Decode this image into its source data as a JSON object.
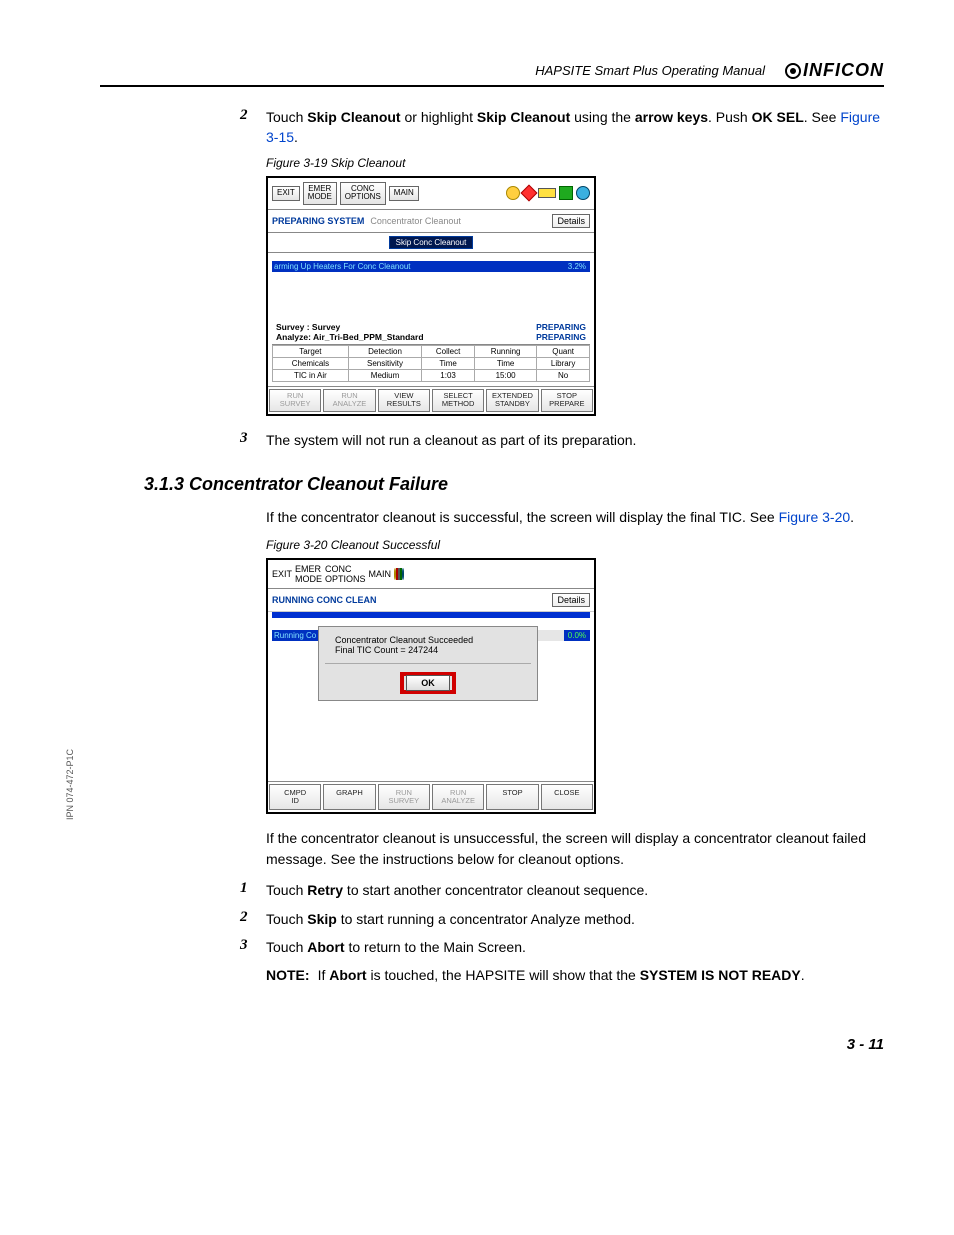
{
  "header": {
    "doc_title": "HAPSITE Smart Plus Operating Manual",
    "logo_text": "INFICON"
  },
  "side_label": "IPN 074-472-P1C",
  "step2": {
    "num": "2",
    "t1": "Touch ",
    "b1": "Skip Cleanout",
    "t2": " or highlight ",
    "b2": "Skip Cleanout",
    "t3": " using the ",
    "b3": "arrow keys",
    "t4": ". Push ",
    "b4": "OK SEL",
    "t5": ". See ",
    "link": "Figure 3-15",
    "t6": "."
  },
  "fig19": {
    "caption": "Figure 3-19  Skip Cleanout",
    "toolbar": {
      "exit": "EXIT",
      "emer1": "EMER",
      "emer2": "MODE",
      "conc1": "CONC",
      "conc2": "OPTIONS",
      "main": "MAIN"
    },
    "status": {
      "prep": "PREPARING SYSTEM",
      "tag": "Concentrator Cleanout",
      "details": "Details"
    },
    "skip_btn": "Skip Conc Cleanout",
    "prog": {
      "msg": "arming Up Heaters For Conc Cleanout",
      "val": "3.2%"
    },
    "survey": {
      "l": "Survey : Survey",
      "r": "PREPARING"
    },
    "analyze": {
      "l": "Analyze: Air_Tri-Bed_PPM_Standard",
      "r": "PREPARING"
    },
    "params": {
      "h": [
        "Target",
        "Detection",
        "Collect",
        "Running",
        "Quant"
      ],
      "r1": [
        "Chemicals",
        "Sensitivity",
        "Time",
        "Time",
        "Library"
      ],
      "r2": [
        "TIC in Air",
        "Medium",
        "1:03",
        "15:00",
        "No"
      ]
    },
    "bottom": {
      "b0a": "RUN",
      "b0b": "SURVEY",
      "b1a": "RUN",
      "b1b": "ANALYZE",
      "b2a": "VIEW",
      "b2b": "RESULTS",
      "b3a": "SELECT",
      "b3b": "METHOD",
      "b4a": "EXTENDED",
      "b4b": "STANDBY",
      "b5a": "STOP",
      "b5b": "PREPARE"
    }
  },
  "step3": {
    "num": "3",
    "text": "The system will not run a cleanout as part of its preparation."
  },
  "section": "3.1.3  Concentrator Cleanout Failure",
  "para1": {
    "t1": "If the concentrator cleanout is successful, the screen will display the final TIC. See ",
    "link": "Figure 3-20",
    "t2": "."
  },
  "fig20": {
    "caption": "Figure 3-20  Cleanout Successful",
    "toolbar": {
      "exit": "EXIT",
      "emer1": "EMER",
      "emer2": "MODE",
      "conc1": "CONC",
      "conc2": "OPTIONS",
      "main": "MAIN"
    },
    "status": {
      "run": "RUNNING CONC CLEAN",
      "details": "Details"
    },
    "prog": {
      "msg": "Running Co",
      "val": "0.0%"
    },
    "dialog": {
      "l1": "Concentrator Cleanout Succeeded",
      "l2": "Final TIC Count = 247244",
      "ok": "OK"
    },
    "bottom": {
      "b0a": "CMPD",
      "b0b": "ID",
      "b1": "GRAPH",
      "b2a": "RUN",
      "b2b": "SURVEY",
      "b3a": "RUN",
      "b3b": "ANALYZE",
      "b4": "STOP",
      "b5": "CLOSE"
    }
  },
  "para2": "If the concentrator cleanout is unsuccessful, the screen will display a concentrator cleanout failed message. See the instructions below for cleanout options.",
  "fstep1": {
    "num": "1",
    "t1": "Touch ",
    "b": "Retry",
    "t2": " to start another concentrator cleanout sequence."
  },
  "fstep2": {
    "num": "2",
    "t1": "Touch ",
    "b": "Skip",
    "t2": " to start running a concentrator Analyze method."
  },
  "fstep3": {
    "num": "3",
    "t1": "Touch ",
    "b": "Abort",
    "t2": " to return to the Main Screen."
  },
  "note": {
    "label": "NOTE:",
    "t1": "If ",
    "b1": "Abort",
    "t2": " is touched, the HAPSITE will show that the ",
    "b2": "SYSTEM IS NOT READY",
    "t3": "."
  },
  "page_num": "3 - 11"
}
